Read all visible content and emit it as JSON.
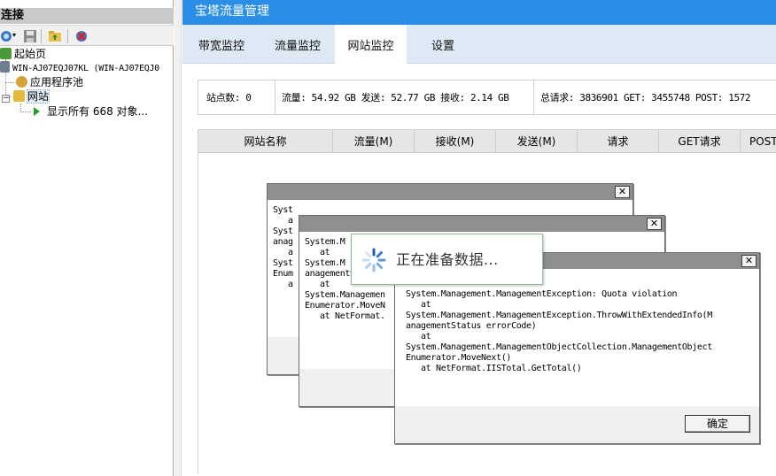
{
  "left_pane": {
    "title": "连接",
    "tree": {
      "start_page": "起始页",
      "server": "WIN-AJ07EQJ07KL (WIN-AJ07EQJ0",
      "app_pools": "应用程序池",
      "sites": "网站",
      "show_all": "显示所有 668 对象..."
    }
  },
  "app": {
    "title": "宝塔流量管理",
    "tabs": [
      "带宽监控",
      "流量监控",
      "网站监控",
      "设置"
    ],
    "active_tab": "网站监控",
    "stats": {
      "sites": "站点数: 0",
      "traffic": "流量: 54.92 GB  发送: 52.77 GB  接收: 2.14 GB",
      "requests": "总请求: 3836901   GET: 3455748   POST: 1572"
    },
    "grid_columns": [
      "网站名称",
      "流量(M)",
      "接收(M)",
      "发送(M)",
      "请求",
      "GET请求",
      "POST请求"
    ]
  },
  "dialogs": {
    "back": {
      "close": "✕",
      "text": "Syst\n   a\nSyst\nanag\n   a\nSyst\nEnum\n   a"
    },
    "middle": {
      "close": "✕",
      "text": "System.M\n   at\nSystem.M\nanagementStatus\n   at\nSystem.Managemen\nEnumerator.MoveN\n   at NetFormat."
    },
    "front": {
      "close": "✕",
      "text": "System.Management.ManagementException: Quota violation\n   at\nSystem.Management.ManagementException.ThrowWithExtendedInfo(M\nanagementStatus errorCode)\n   at\nSystem.Management.ManagementObjectCollection.ManagementObject\nEnumerator.MoveNext()\n   at NetFormat.IISTotal.GetTotal()",
      "ok": "确定"
    }
  },
  "loading": {
    "text": "正在准备数据..."
  },
  "colors": {
    "title_bar": "#2b8ee6",
    "tab_bar": "#dde9f5",
    "dialog_caption": "#8f8f8f"
  }
}
